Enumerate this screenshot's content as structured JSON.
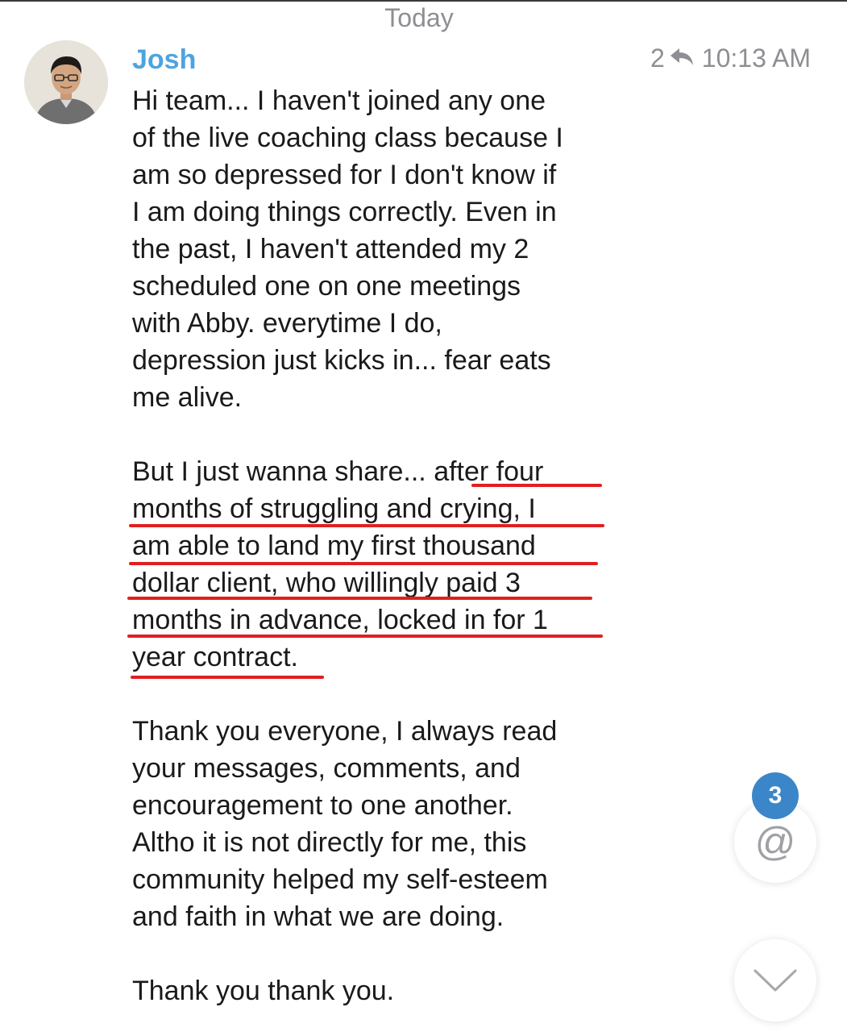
{
  "date_separator": "Today",
  "message": {
    "sender": "Josh",
    "reply_count": "2",
    "reply_icon": "reply-arrow-icon",
    "time": "10:13 AM",
    "lines": [
      "Hi team... I haven't joined any one",
      "of the live coaching class because I",
      "am so depressed for I don't know if",
      "I am doing things correctly. Even in",
      "the past, I haven't attended my 2",
      "scheduled one on one meetings",
      "with Abby. everytime I do,",
      "depression just kicks in... fear eats",
      "me alive.",
      "",
      "But I just wanna share... after four",
      "months of struggling and crying, I",
      "am able to land my first thousand",
      "dollar client, who willingly paid 3",
      "months in advance, locked in for 1",
      "year contract.",
      "",
      "Thank you everyone, I always read",
      "your messages, comments, and",
      "encouragement to one another.",
      "Altho it is not directly for me, this",
      "community helped my self-esteem",
      "and faith in what we are doing.",
      "",
      "Thank you thank you."
    ],
    "highlight_color": "#e02020"
  },
  "mentions": {
    "icon": "at-icon",
    "glyph": "@",
    "badge_count": "3"
  },
  "scroll_down": {
    "icon": "chevron-down-icon"
  },
  "colors": {
    "sender": "#4da3e0",
    "badge": "#3b86c8",
    "meta": "#8e8e93"
  }
}
